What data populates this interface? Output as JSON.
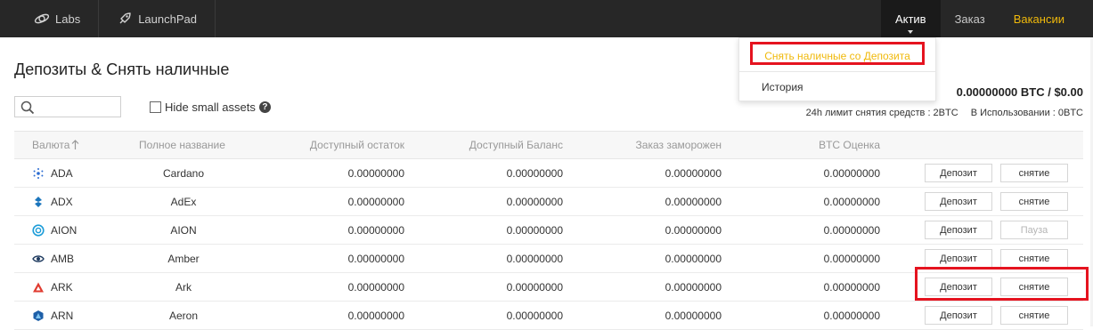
{
  "topbar": {
    "left_items": [
      {
        "label": "Labs",
        "icon": "labs-icon"
      },
      {
        "label": "LaunchPad",
        "icon": "rocket-icon"
      }
    ],
    "right_items": [
      {
        "label": "Актив"
      },
      {
        "label": "Заказ"
      },
      {
        "label": "Вакансии"
      }
    ]
  },
  "dropdown": {
    "withdraw_label": "Снять наличные со Депозита",
    "history_label": "История"
  },
  "page": {
    "title": "Депозиты & Снять наличные",
    "hide_small_label": "Hide small assets",
    "help_glyph": "?",
    "total_balance": "0.00000000 BTC / $0.00",
    "limit_text": "24h лимит снятия средств : 2BTC",
    "in_use_text": "В Использовании : 0BTC"
  },
  "table": {
    "headers": {
      "coin": "Валюта",
      "name": "Полное название",
      "available": "Доступный остаток",
      "balance": "Доступный Баланс",
      "in_order": "Заказ заморожен",
      "btc_value": "BTC Оценка"
    },
    "rows": [
      {
        "coin": "ADA",
        "name": "Cardano",
        "available": "0.00000000",
        "balance": "0.00000000",
        "in_order": "0.00000000",
        "btc_value": "0.00000000",
        "deposit": "Депозит",
        "withdraw": "снятие",
        "icon": "cardano-icon"
      },
      {
        "coin": "ADX",
        "name": "AdEx",
        "available": "0.00000000",
        "balance": "0.00000000",
        "in_order": "0.00000000",
        "btc_value": "0.00000000",
        "deposit": "Депозит",
        "withdraw": "снятие",
        "icon": "adex-icon"
      },
      {
        "coin": "AION",
        "name": "AION",
        "available": "0.00000000",
        "balance": "0.00000000",
        "in_order": "0.00000000",
        "btc_value": "0.00000000",
        "deposit": "Депозит",
        "withdraw": "Пауза",
        "icon": "aion-icon"
      },
      {
        "coin": "AMB",
        "name": "Amber",
        "available": "0.00000000",
        "balance": "0.00000000",
        "in_order": "0.00000000",
        "btc_value": "0.00000000",
        "deposit": "Депозит",
        "withdraw": "снятие",
        "icon": "amber-icon"
      },
      {
        "coin": "ARK",
        "name": "Ark",
        "available": "0.00000000",
        "balance": "0.00000000",
        "in_order": "0.00000000",
        "btc_value": "0.00000000",
        "deposit": "Депозит",
        "withdraw": "снятие",
        "icon": "ark-icon"
      },
      {
        "coin": "ARN",
        "name": "Aeron",
        "available": "0.00000000",
        "balance": "0.00000000",
        "in_order": "0.00000000",
        "btc_value": "0.00000000",
        "deposit": "Депозит",
        "withdraw": "снятие",
        "icon": "aeron-icon"
      }
    ]
  },
  "colors": {
    "topbar_bg": "#272727",
    "accent": "#f0b90b",
    "highlight": "#e5131f"
  }
}
